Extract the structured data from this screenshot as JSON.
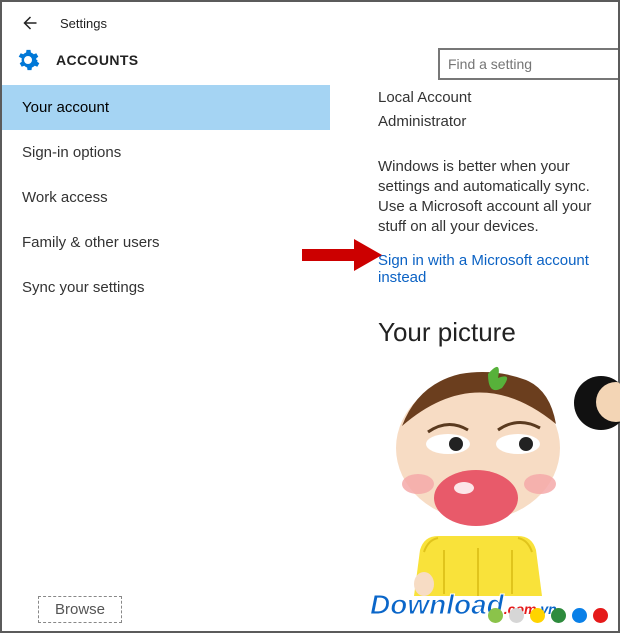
{
  "window": {
    "title": "Settings"
  },
  "header": {
    "section": "ACCOUNTS"
  },
  "search": {
    "placeholder": "Find a setting"
  },
  "sidebar": {
    "items": [
      {
        "label": "Your account"
      },
      {
        "label": "Sign-in options"
      },
      {
        "label": "Work access"
      },
      {
        "label": "Family & other users"
      },
      {
        "label": "Sync your settings"
      }
    ]
  },
  "panel": {
    "account_type_line1": "Local Account",
    "account_type_line2": "Administrator",
    "sync_text": "Windows is better when your settings and automatically sync. Use a Microsoft account all your stuff on all your devices.",
    "signin_link": "Sign in with a Microsoft account instead",
    "picture_heading": "Your picture",
    "browse_label": "Browse"
  },
  "watermark": {
    "brand": "Download",
    "suffix": ".com.vn",
    "dot_colors": [
      "#8bc34a",
      "#d6d6d6",
      "#ffd400",
      "#2e8b3d",
      "#0a80e8",
      "#e51a1a"
    ]
  }
}
